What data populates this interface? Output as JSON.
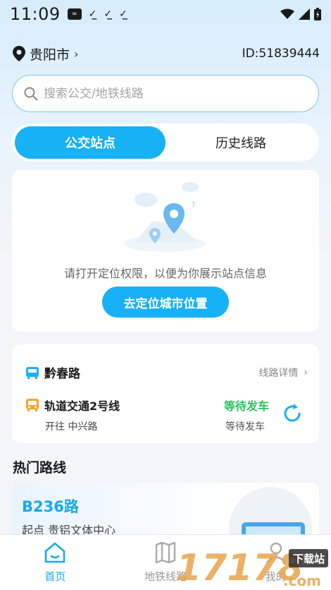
{
  "status_bar": {
    "time": "11:09"
  },
  "header": {
    "city": "贵阳市",
    "user_id": "ID:51839444"
  },
  "search": {
    "placeholder": "搜索公交/地铁线路"
  },
  "tabs": [
    {
      "label": "公交站点",
      "active": true
    },
    {
      "label": "历史线路",
      "active": false
    }
  ],
  "location_prompt": {
    "message": "请打开定位权限，以便为你展示站点信息",
    "button_label": "去定位城市位置"
  },
  "station": {
    "name": "黔春路",
    "detail_label": "线路详情",
    "line": {
      "name": "轨道交通2号线",
      "direction": "开往 中兴路",
      "status": "等待发车",
      "status_sub": "等待发车"
    }
  },
  "hot_routes": {
    "title": "热门路线",
    "items": [
      {
        "name": "B236路",
        "start": "起点 贵铝文体中心"
      }
    ]
  },
  "bottom_nav": [
    {
      "label": "首页",
      "icon": "home-icon",
      "active": true
    },
    {
      "label": "地铁线路",
      "icon": "map-icon",
      "active": false
    },
    {
      "label": "我的",
      "icon": "user-icon",
      "active": false
    }
  ],
  "watermark": {
    "text": "17178",
    "badge": "下载站",
    "suffix": ".com"
  },
  "colors": {
    "accent": "#17b1f5",
    "status_green": "#2dc25c",
    "bus_orange": "#f5a623"
  }
}
